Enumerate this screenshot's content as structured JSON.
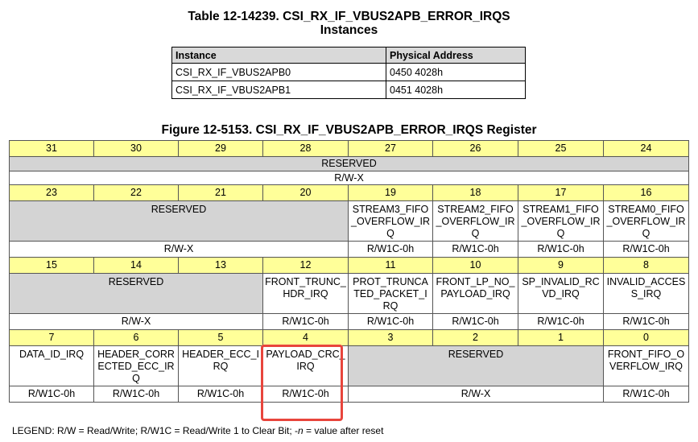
{
  "table_title": [
    "Table 12-14239. CSI_RX_IF_VBUS2APB_ERROR_IRQS",
    "Instances"
  ],
  "instances": {
    "headers": [
      "Instance",
      "Physical Address"
    ],
    "rows": [
      [
        "CSI_RX_IF_VBUS2APB0",
        "0450 4028h"
      ],
      [
        "CSI_RX_IF_VBUS2APB1",
        "0451 4028h"
      ]
    ]
  },
  "figure_title": "Figure 12-5153. CSI_RX_IF_VBUS2APB_ERROR_IRQS Register",
  "register": {
    "bit_rows": [
      [
        "31",
        "30",
        "29",
        "28",
        "27",
        "26",
        "25",
        "24"
      ],
      [
        "23",
        "22",
        "21",
        "20",
        "19",
        "18",
        "17",
        "16"
      ],
      [
        "15",
        "14",
        "13",
        "12",
        "11",
        "10",
        "9",
        "8"
      ],
      [
        "7",
        "6",
        "5",
        "4",
        "3",
        "2",
        "1",
        "0"
      ]
    ],
    "r1": {
      "field": "RESERVED",
      "access": "R/W-X"
    },
    "r2": {
      "fields": [
        "RESERVED",
        "STREAM3_FIFO_OVERFLOW_IRQ",
        "STREAM2_FIFO_OVERFLOW_IRQ",
        "STREAM1_FIFO_OVERFLOW_IRQ",
        "STREAM0_FIFO_OVERFLOW_IRQ"
      ],
      "access": [
        "R/W-X",
        "R/W1C-0h",
        "R/W1C-0h",
        "R/W1C-0h",
        "R/W1C-0h"
      ]
    },
    "r3": {
      "fields": [
        "RESERVED",
        "FRONT_TRUNC_HDR_IRQ",
        "PROT_TRUNCATED_PACKET_IRQ",
        "FRONT_LP_NO_PAYLOAD_IRQ",
        "SP_INVALID_RCVD_IRQ",
        "INVALID_ACCESS_IRQ"
      ],
      "access": [
        "R/W-X",
        "R/W1C-0h",
        "R/W1C-0h",
        "R/W1C-0h",
        "R/W1C-0h",
        "R/W1C-0h"
      ]
    },
    "r4": {
      "fields": [
        "DATA_ID_IRQ",
        "HEADER_CORRECTED_ECC_IRQ",
        "HEADER_ECC_IRQ",
        "PAYLOAD_CRC_IRQ",
        "RESERVED",
        "FRONT_FIFO_OVERFLOW_IRQ"
      ],
      "access": [
        "R/W1C-0h",
        "R/W1C-0h",
        "R/W1C-0h",
        "R/W1C-0h",
        "R/W-X",
        "R/W1C-0h"
      ]
    }
  },
  "legend": "LEGEND: R/W = Read/Write; R/W1C = Read/Write 1 to Clear Bit; -n = value after reset",
  "colors": {
    "bit_header": "#ffff99",
    "reserved": "#d4d4d4",
    "highlight": "#e8453c"
  }
}
